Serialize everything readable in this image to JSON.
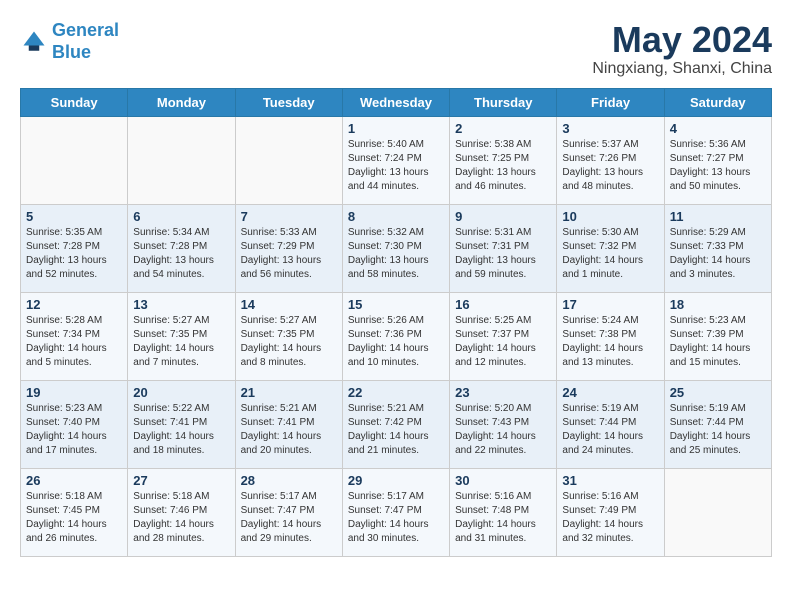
{
  "header": {
    "logo_line1": "General",
    "logo_line2": "Blue",
    "month_title": "May 2024",
    "location": "Ningxiang, Shanxi, China"
  },
  "weekdays": [
    "Sunday",
    "Monday",
    "Tuesday",
    "Wednesday",
    "Thursday",
    "Friday",
    "Saturday"
  ],
  "weeks": [
    [
      {
        "num": "",
        "info": ""
      },
      {
        "num": "",
        "info": ""
      },
      {
        "num": "",
        "info": ""
      },
      {
        "num": "1",
        "info": "Sunrise: 5:40 AM\nSunset: 7:24 PM\nDaylight: 13 hours\nand 44 minutes."
      },
      {
        "num": "2",
        "info": "Sunrise: 5:38 AM\nSunset: 7:25 PM\nDaylight: 13 hours\nand 46 minutes."
      },
      {
        "num": "3",
        "info": "Sunrise: 5:37 AM\nSunset: 7:26 PM\nDaylight: 13 hours\nand 48 minutes."
      },
      {
        "num": "4",
        "info": "Sunrise: 5:36 AM\nSunset: 7:27 PM\nDaylight: 13 hours\nand 50 minutes."
      }
    ],
    [
      {
        "num": "5",
        "info": "Sunrise: 5:35 AM\nSunset: 7:28 PM\nDaylight: 13 hours\nand 52 minutes."
      },
      {
        "num": "6",
        "info": "Sunrise: 5:34 AM\nSunset: 7:28 PM\nDaylight: 13 hours\nand 54 minutes."
      },
      {
        "num": "7",
        "info": "Sunrise: 5:33 AM\nSunset: 7:29 PM\nDaylight: 13 hours\nand 56 minutes."
      },
      {
        "num": "8",
        "info": "Sunrise: 5:32 AM\nSunset: 7:30 PM\nDaylight: 13 hours\nand 58 minutes."
      },
      {
        "num": "9",
        "info": "Sunrise: 5:31 AM\nSunset: 7:31 PM\nDaylight: 13 hours\nand 59 minutes."
      },
      {
        "num": "10",
        "info": "Sunrise: 5:30 AM\nSunset: 7:32 PM\nDaylight: 14 hours\nand 1 minute."
      },
      {
        "num": "11",
        "info": "Sunrise: 5:29 AM\nSunset: 7:33 PM\nDaylight: 14 hours\nand 3 minutes."
      }
    ],
    [
      {
        "num": "12",
        "info": "Sunrise: 5:28 AM\nSunset: 7:34 PM\nDaylight: 14 hours\nand 5 minutes."
      },
      {
        "num": "13",
        "info": "Sunrise: 5:27 AM\nSunset: 7:35 PM\nDaylight: 14 hours\nand 7 minutes."
      },
      {
        "num": "14",
        "info": "Sunrise: 5:27 AM\nSunset: 7:35 PM\nDaylight: 14 hours\nand 8 minutes."
      },
      {
        "num": "15",
        "info": "Sunrise: 5:26 AM\nSunset: 7:36 PM\nDaylight: 14 hours\nand 10 minutes."
      },
      {
        "num": "16",
        "info": "Sunrise: 5:25 AM\nSunset: 7:37 PM\nDaylight: 14 hours\nand 12 minutes."
      },
      {
        "num": "17",
        "info": "Sunrise: 5:24 AM\nSunset: 7:38 PM\nDaylight: 14 hours\nand 13 minutes."
      },
      {
        "num": "18",
        "info": "Sunrise: 5:23 AM\nSunset: 7:39 PM\nDaylight: 14 hours\nand 15 minutes."
      }
    ],
    [
      {
        "num": "19",
        "info": "Sunrise: 5:23 AM\nSunset: 7:40 PM\nDaylight: 14 hours\nand 17 minutes."
      },
      {
        "num": "20",
        "info": "Sunrise: 5:22 AM\nSunset: 7:41 PM\nDaylight: 14 hours\nand 18 minutes."
      },
      {
        "num": "21",
        "info": "Sunrise: 5:21 AM\nSunset: 7:41 PM\nDaylight: 14 hours\nand 20 minutes."
      },
      {
        "num": "22",
        "info": "Sunrise: 5:21 AM\nSunset: 7:42 PM\nDaylight: 14 hours\nand 21 minutes."
      },
      {
        "num": "23",
        "info": "Sunrise: 5:20 AM\nSunset: 7:43 PM\nDaylight: 14 hours\nand 22 minutes."
      },
      {
        "num": "24",
        "info": "Sunrise: 5:19 AM\nSunset: 7:44 PM\nDaylight: 14 hours\nand 24 minutes."
      },
      {
        "num": "25",
        "info": "Sunrise: 5:19 AM\nSunset: 7:44 PM\nDaylight: 14 hours\nand 25 minutes."
      }
    ],
    [
      {
        "num": "26",
        "info": "Sunrise: 5:18 AM\nSunset: 7:45 PM\nDaylight: 14 hours\nand 26 minutes."
      },
      {
        "num": "27",
        "info": "Sunrise: 5:18 AM\nSunset: 7:46 PM\nDaylight: 14 hours\nand 28 minutes."
      },
      {
        "num": "28",
        "info": "Sunrise: 5:17 AM\nSunset: 7:47 PM\nDaylight: 14 hours\nand 29 minutes."
      },
      {
        "num": "29",
        "info": "Sunrise: 5:17 AM\nSunset: 7:47 PM\nDaylight: 14 hours\nand 30 minutes."
      },
      {
        "num": "30",
        "info": "Sunrise: 5:16 AM\nSunset: 7:48 PM\nDaylight: 14 hours\nand 31 minutes."
      },
      {
        "num": "31",
        "info": "Sunrise: 5:16 AM\nSunset: 7:49 PM\nDaylight: 14 hours\nand 32 minutes."
      },
      {
        "num": "",
        "info": ""
      }
    ]
  ]
}
